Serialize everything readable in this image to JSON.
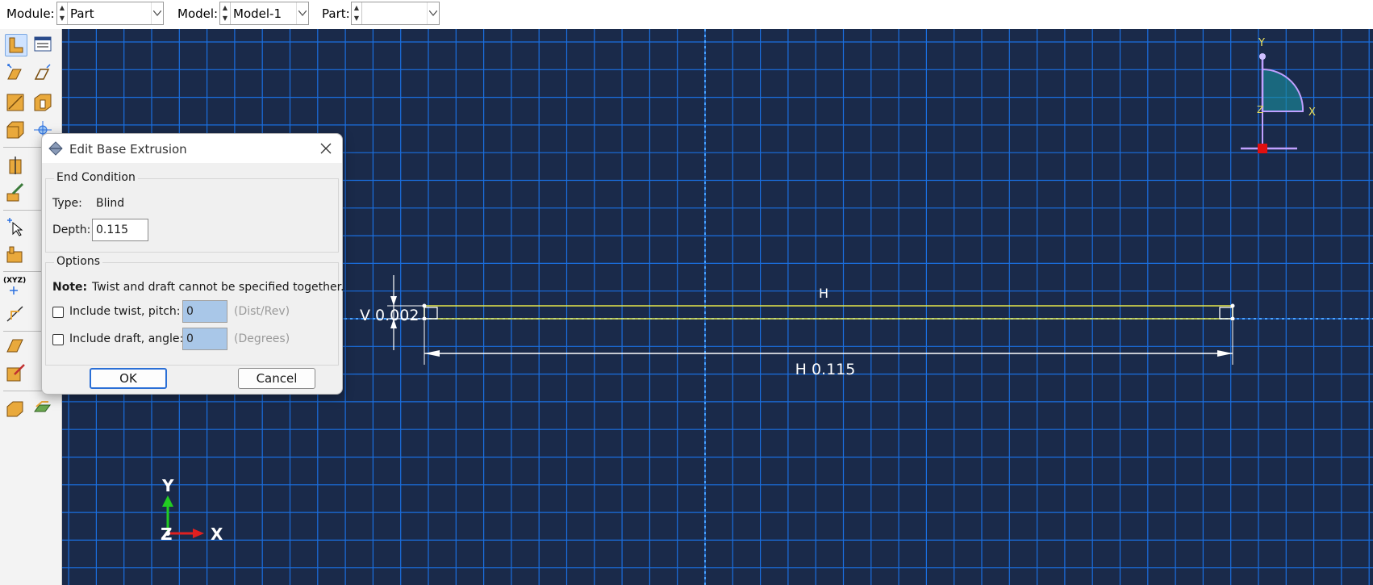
{
  "context_bar": {
    "module_label": "Module:",
    "module_value": "Part",
    "model_label": "Model:",
    "model_value": "Model-1",
    "part_label": "Part:",
    "part_value": ""
  },
  "toolbox": {
    "xyz_label": "(XYZ)"
  },
  "viewport": {
    "background": "#1a2a4a",
    "grid_color": "#1a6fe0",
    "sketch_color": "#e6e84a",
    "dimension_color": "#ffffff",
    "constraint_label": "H",
    "dim_vertical": "V 0.002",
    "dim_horizontal": "H 0.115",
    "triad_top": {
      "y": "Y",
      "x": "X",
      "z": "Z"
    },
    "triad_bottom": {
      "y": "Y",
      "x": "X",
      "z": "Z"
    }
  },
  "dialog": {
    "title": "Edit Base Extrusion",
    "end_condition": {
      "legend": "End Condition",
      "type_label": "Type:",
      "type_value": "Blind",
      "depth_label": "Depth:",
      "depth_value": "0.115"
    },
    "options": {
      "legend": "Options",
      "note_label": "Note:",
      "note_text": "Twist and draft cannot be specified together.",
      "twist_label": "Include twist, pitch:",
      "twist_value": "0",
      "twist_unit": "(Dist/Rev)",
      "draft_label": "Include draft, angle:",
      "draft_value": "0",
      "draft_unit": "(Degrees)"
    },
    "ok_label": "OK",
    "cancel_label": "Cancel"
  }
}
